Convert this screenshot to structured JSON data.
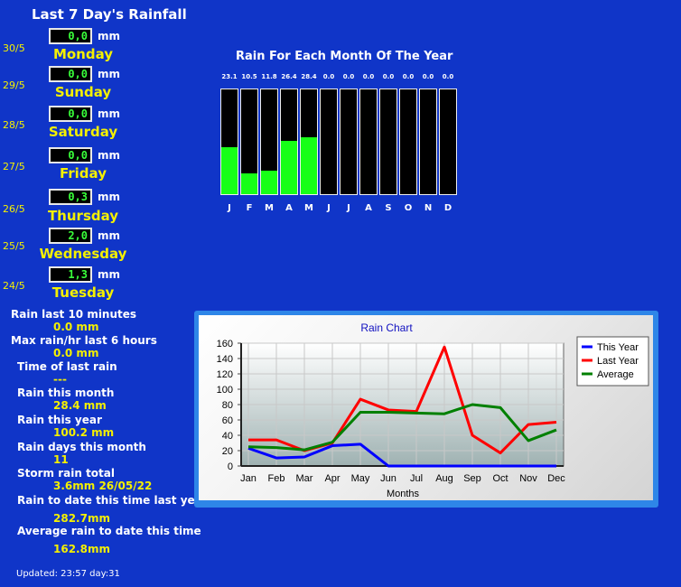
{
  "page": {
    "title": "Last 7 Day's Rainfall",
    "updated": "Updated: 23:57 day:31"
  },
  "days": [
    {
      "date": "30/5",
      "value": "0,0",
      "unit": "mm",
      "day": "Monday"
    },
    {
      "date": "29/5",
      "value": "0,0",
      "unit": "mm",
      "day": "Sunday"
    },
    {
      "date": "28/5",
      "value": "0,0",
      "unit": "mm",
      "day": "Saturday"
    },
    {
      "date": "27/5",
      "value": "0,0",
      "unit": "mm",
      "day": "Friday"
    },
    {
      "date": "26/5",
      "value": "0,3",
      "unit": "mm",
      "day": "Thursday"
    },
    {
      "date": "25/5",
      "value": "2,0",
      "unit": "mm",
      "day": "Wednesday"
    },
    {
      "date": "24/5",
      "value": "1,3",
      "unit": "mm",
      "day": "Tuesday"
    }
  ],
  "stats": [
    {
      "label": "Rain last 10 minutes",
      "value": "0.0 mm"
    },
    {
      "label": "Max rain/hr last 6 hours",
      "value": "0.0 mm"
    },
    {
      "label": "Time of last rain",
      "value": "---"
    },
    {
      "label": "Rain this month",
      "value": "28.4 mm"
    },
    {
      "label": "Rain this year",
      "value": "100.2 mm"
    },
    {
      "label": "Rain days this month",
      "value": "11"
    },
    {
      "label": "Storm rain total",
      "value": "3.6mm 26/05/22"
    },
    {
      "label": "Rain to date this time last year",
      "value": "282.7mm"
    },
    {
      "label": "Average rain to date this time",
      "value": "162.8mm"
    }
  ],
  "monthly": {
    "title": "Rain For Each Month Of The Year",
    "values": [
      "23.1",
      "10.5",
      "11.8",
      "26.4",
      "28.4",
      "0.0",
      "0.0",
      "0.0",
      "0.0",
      "0.0",
      "0.0",
      "0.0"
    ],
    "labels": [
      "J",
      "F",
      "M",
      "A",
      "M",
      "J",
      "J",
      "A",
      "S",
      "O",
      "N",
      "D"
    ],
    "max_scale": 52.0
  },
  "chart_data": {
    "type": "line",
    "title": "Rain Chart",
    "xlabel": "Months",
    "ylabel": "",
    "categories": [
      "Jan",
      "Feb",
      "Mar",
      "Apr",
      "May",
      "Jun",
      "Jul",
      "Aug",
      "Sep",
      "Oct",
      "Nov",
      "Dec"
    ],
    "ylim": [
      0,
      160
    ],
    "yticks": [
      "0",
      "20",
      "40",
      "60",
      "80",
      "100",
      "120",
      "140",
      "160"
    ],
    "grid": true,
    "legend": "top-right",
    "series": [
      {
        "name": "This Year",
        "color": "#0000ff",
        "values": [
          23.1,
          10.5,
          11.8,
          26.4,
          28.4,
          0,
          0,
          0,
          0,
          0,
          0,
          0
        ]
      },
      {
        "name": "Last Year",
        "color": "#ff0000",
        "values": [
          34,
          34,
          20,
          30,
          87,
          73,
          71,
          155,
          40,
          17,
          54,
          57
        ]
      },
      {
        "name": "Average",
        "color": "#008000",
        "values": [
          25,
          24,
          21,
          31,
          70,
          70,
          69,
          68,
          80,
          76,
          33,
          47
        ]
      }
    ]
  }
}
